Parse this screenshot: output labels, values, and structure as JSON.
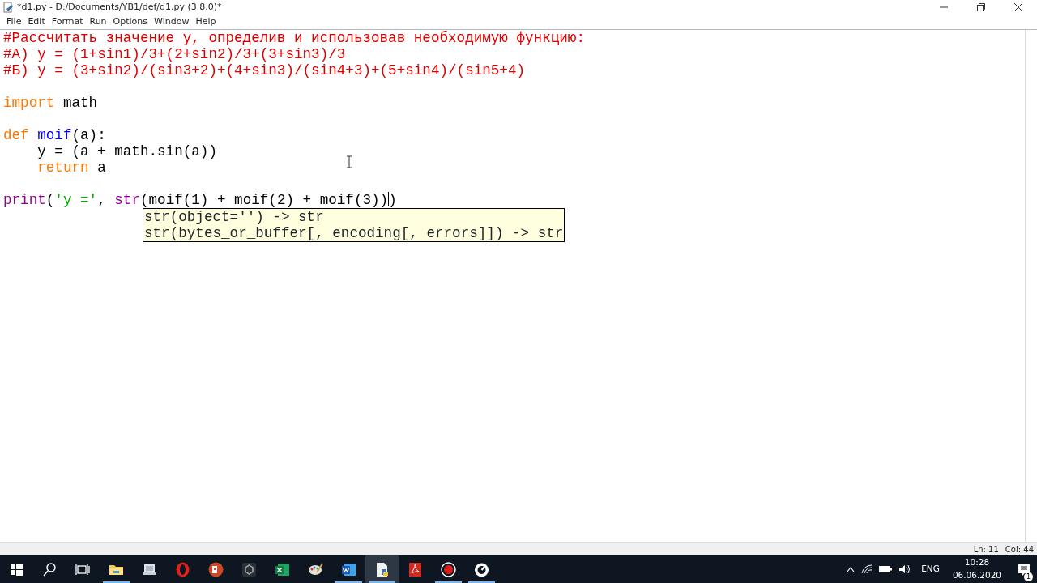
{
  "window": {
    "title": "*d1.py - D:/Documents/YB1/def/d1.py (3.8.0)*"
  },
  "menu": [
    "File",
    "Edit",
    "Format",
    "Run",
    "Options",
    "Window",
    "Help"
  ],
  "editor": {
    "lines": [
      {
        "kind": "code",
        "indented": false,
        "tokens": [
          {
            "kind": "comment",
            "text": "#Рассчитать значение y, определив и использовав необходимую функцию:"
          }
        ]
      },
      {
        "kind": "code",
        "indented": false,
        "tokens": [
          {
            "kind": "comment",
            "text": "#А) y = (1+sin1)/3+(2+sin2)/3+(3+sin3)/3"
          }
        ]
      },
      {
        "kind": "code",
        "indented": false,
        "tokens": [
          {
            "kind": "comment",
            "text": "#Б) y = (3+sin2)/(sin3+2)+(4+sin3)/(sin4+3)+(5+sin4)/(sin5+4)"
          }
        ]
      },
      {
        "kind": "blank"
      },
      {
        "kind": "code",
        "indented": false,
        "tokens": [
          {
            "kind": "keyword",
            "text": "import"
          },
          {
            "kind": "plain",
            "text": " math"
          }
        ]
      },
      {
        "kind": "blank"
      },
      {
        "kind": "code",
        "indented": false,
        "tokens": [
          {
            "kind": "keyword",
            "text": "def"
          },
          {
            "kind": "definition",
            "text": " moif"
          },
          {
            "kind": "plain",
            "text": "(a):"
          }
        ]
      },
      {
        "kind": "code",
        "indented": true,
        "tokens": [
          {
            "kind": "plain",
            "text": "y = (a + math.sin(a))"
          }
        ]
      },
      {
        "kind": "code",
        "indented": true,
        "tokens": [
          {
            "kind": "keyword",
            "text": "return"
          },
          {
            "kind": "plain",
            "text": " a"
          }
        ]
      },
      {
        "kind": "blank"
      },
      {
        "kind": "code",
        "indented": false,
        "tokens": [
          {
            "kind": "builtin",
            "text": "print"
          },
          {
            "kind": "plain",
            "text": "("
          },
          {
            "kind": "string",
            "text": "'y ='"
          },
          {
            "kind": "plain",
            "text": ", "
          },
          {
            "kind": "builtin",
            "text": "str"
          },
          {
            "kind": "plain",
            "text": "(moif(1) + moif(2) + moif(3))"
          },
          {
            "kind": "caret"
          },
          {
            "kind": "plain",
            "text": ")"
          }
        ]
      }
    ],
    "calltip": [
      "str(object='') -> str",
      "str(bytes_or_buffer[, encoding[, errors]]) -> str"
    ]
  },
  "status_bar": {
    "line": "Ln: 11",
    "column": "Col: 44"
  },
  "taskbar": {
    "items": [
      {
        "kind": "start",
        "running": false,
        "selected": false
      },
      {
        "kind": "search",
        "running": false,
        "selected": false
      },
      {
        "kind": "taskview",
        "running": false,
        "selected": false
      },
      {
        "kind": "folder",
        "running": true,
        "selected": false
      },
      {
        "kind": "computer",
        "running": false,
        "selected": false
      },
      {
        "kind": "opera",
        "running": false,
        "selected": false
      },
      {
        "kind": "slides",
        "running": false,
        "selected": false
      },
      {
        "kind": "hexagon",
        "running": false,
        "selected": false
      },
      {
        "kind": "sheet",
        "running": false,
        "selected": false
      },
      {
        "kind": "palette",
        "running": false,
        "selected": false
      },
      {
        "kind": "doc",
        "running": true,
        "selected": false
      },
      {
        "kind": "editor",
        "running": true,
        "selected": true
      },
      {
        "kind": "pdf",
        "running": false,
        "selected": false
      },
      {
        "kind": "record",
        "running": true,
        "selected": false
      },
      {
        "kind": "gauge",
        "running": true,
        "selected": false
      }
    ],
    "language": "ENG",
    "time": "10:28",
    "date": "06.06.2020",
    "notifications": "1"
  }
}
